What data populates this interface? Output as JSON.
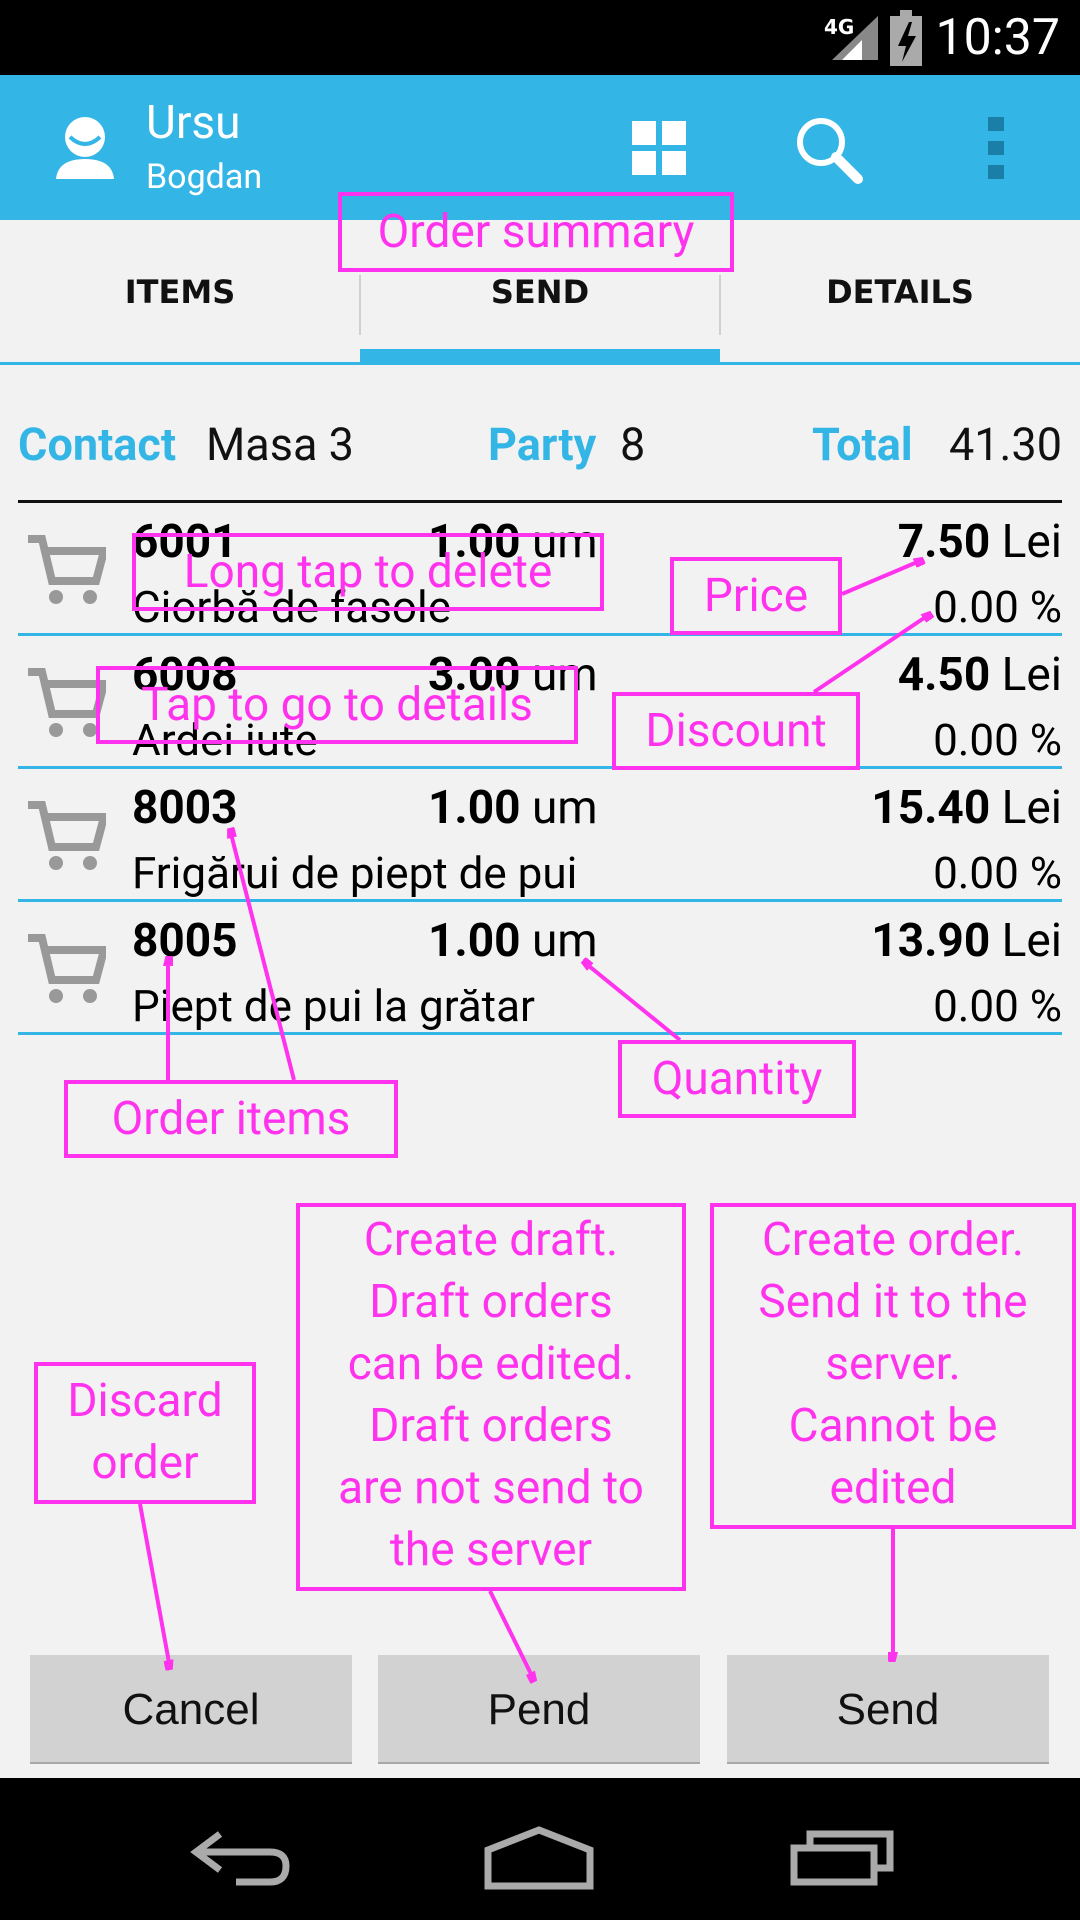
{
  "status_bar": {
    "network": "4G",
    "time": "10:37"
  },
  "appbar": {
    "first_name": "Ursu",
    "last_name": "Bogdan",
    "icons": [
      "grid-icon",
      "search-icon",
      "overflow-menu-icon"
    ]
  },
  "tabs": [
    {
      "label": "ITEMS",
      "selected": false
    },
    {
      "label": "SEND",
      "selected": true
    },
    {
      "label": "DETAILS",
      "selected": false
    }
  ],
  "summary": {
    "contact_label": "Contact",
    "contact_value": "Masa 3",
    "party_label": "Party",
    "party_value": "8",
    "total_label": "Total",
    "total_value": "41.30"
  },
  "items": [
    {
      "code": "6001",
      "qty": "1.00",
      "unit": "um",
      "price": "7.50",
      "currency": "Lei",
      "name": "Ciorbă de fasole",
      "discount": "0.00 %"
    },
    {
      "code": "6008",
      "qty": "3.00",
      "unit": "um",
      "price": "4.50",
      "currency": "Lei",
      "name": "Ardei iute",
      "discount": "0.00 %"
    },
    {
      "code": "8003",
      "qty": "1.00",
      "unit": "um",
      "price": "15.40",
      "currency": "Lei",
      "name": "Frigărui de piept de pui",
      "discount": "0.00 %"
    },
    {
      "code": "8005",
      "qty": "1.00",
      "unit": "um",
      "price": "13.90",
      "currency": "Lei",
      "name": "Piept de pui la grătar",
      "discount": "0.00 %"
    }
  ],
  "buttons": {
    "cancel": "Cancel",
    "pend": "Pend",
    "send": "Send"
  },
  "annotations": {
    "order_summary": "Order summary",
    "long_tap": "Long tap to delete",
    "tap_details": "Tap to go to details",
    "price": "Price",
    "discount": "Discount",
    "quantity": "Quantity",
    "order_items": "Order items",
    "discard": [
      "Discard",
      "order"
    ],
    "draft": [
      "Create draft.",
      "Draft orders",
      "can be edited.",
      "Draft orders",
      "are not send to",
      "the server"
    ],
    "create_order": [
      "Create order.",
      "Send it to the",
      "server.",
      "Cannot be",
      "edited"
    ]
  },
  "colors": {
    "accent": "#33b5e5",
    "annotation": "#ff33ee"
  }
}
